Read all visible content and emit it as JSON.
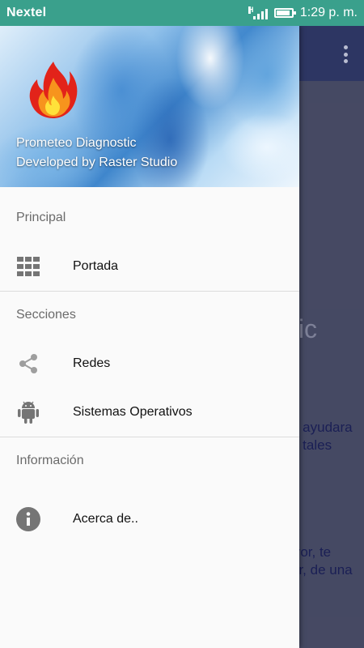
{
  "status_bar": {
    "carrier": "Nextel",
    "network_icon": "signal-icon",
    "network_letter": "H",
    "battery_icon": "battery-icon",
    "time": "1:29 p. m."
  },
  "drawer": {
    "header": {
      "logo_icon": "fire-icon",
      "line1": "Prometeo Diagnostic",
      "line2": "Developed by Raster Studio"
    },
    "sections": [
      {
        "title": "Principal",
        "items": [
          {
            "label": "Portada",
            "icon": "grid-icon"
          }
        ]
      },
      {
        "title": "Secciones",
        "items": [
          {
            "label": "Redes",
            "icon": "share-icon"
          },
          {
            "label": "Sistemas Operativos",
            "icon": "android-icon"
          }
        ]
      },
      {
        "title": "Información",
        "items": [
          {
            "label": "Acerca de..",
            "icon": "info-icon"
          }
        ]
      }
    ]
  },
  "background": {
    "toolbar_menu_icon": "overflow-menu-icon",
    "title_fragment": "tic",
    "text1a": "e ayudara",
    "text1b": "a tales",
    "text2a": "rror, te",
    "text2b": "or, de una"
  },
  "colors": {
    "status_bar": "#3aa08c",
    "toolbar": "#2f3a6a",
    "dim_background": "#4b4f6a",
    "drawer": "#fafafa"
  }
}
